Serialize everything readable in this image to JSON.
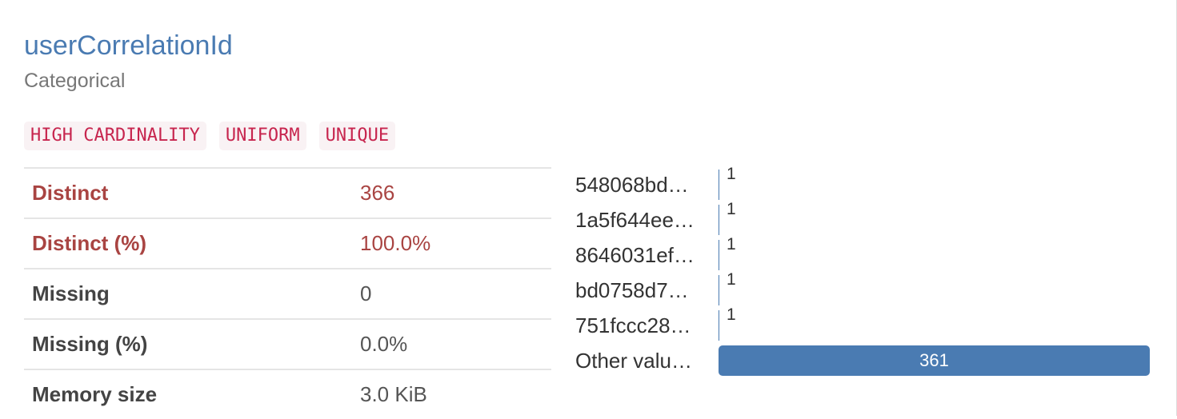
{
  "variable": {
    "name": "userCorrelationId",
    "type": "Categorical"
  },
  "badges": [
    "HIGH CARDINALITY",
    "UNIFORM",
    "UNIQUE"
  ],
  "stats": [
    {
      "label": "Distinct",
      "value": "366",
      "alert": true
    },
    {
      "label": "Distinct (%)",
      "value": "100.0%",
      "alert": true
    },
    {
      "label": "Missing",
      "value": "0",
      "alert": false
    },
    {
      "label": "Missing (%)",
      "value": "0.0%",
      "alert": false
    },
    {
      "label": "Memory size",
      "value": "3.0 KiB",
      "alert": false
    }
  ],
  "frequencies": [
    {
      "label": "548068bd…",
      "count": "1"
    },
    {
      "label": "1a5f644ee…",
      "count": "1"
    },
    {
      "label": "8646031ef…",
      "count": "1"
    },
    {
      "label": "bd0758d7…",
      "count": "1"
    },
    {
      "label": "751fccc28…",
      "count": "1"
    },
    {
      "label": "Other valu…",
      "count": "361"
    }
  ],
  "colors": {
    "title": "#4a7bb2",
    "bar": "#4a7bb2",
    "alert": "#a94442",
    "badge_text": "#c7254e",
    "badge_bg": "#f9f2f4"
  }
}
